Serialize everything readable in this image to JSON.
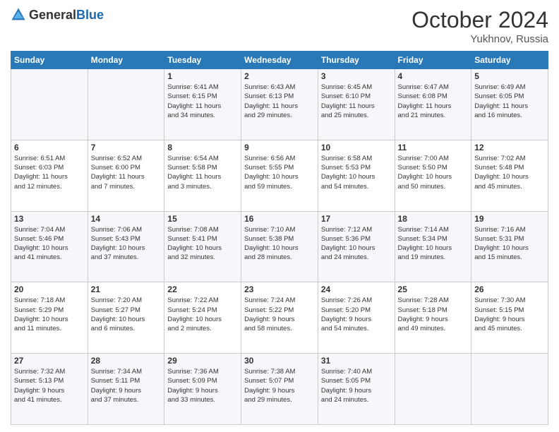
{
  "header": {
    "logo_general": "General",
    "logo_blue": "Blue",
    "month_title": "October 2024",
    "location": "Yukhnov, Russia"
  },
  "days_of_week": [
    "Sunday",
    "Monday",
    "Tuesday",
    "Wednesday",
    "Thursday",
    "Friday",
    "Saturday"
  ],
  "weeks": [
    [
      {
        "day": "",
        "info": ""
      },
      {
        "day": "",
        "info": ""
      },
      {
        "day": "1",
        "info": "Sunrise: 6:41 AM\nSunset: 6:15 PM\nDaylight: 11 hours\nand 34 minutes."
      },
      {
        "day": "2",
        "info": "Sunrise: 6:43 AM\nSunset: 6:13 PM\nDaylight: 11 hours\nand 29 minutes."
      },
      {
        "day": "3",
        "info": "Sunrise: 6:45 AM\nSunset: 6:10 PM\nDaylight: 11 hours\nand 25 minutes."
      },
      {
        "day": "4",
        "info": "Sunrise: 6:47 AM\nSunset: 6:08 PM\nDaylight: 11 hours\nand 21 minutes."
      },
      {
        "day": "5",
        "info": "Sunrise: 6:49 AM\nSunset: 6:05 PM\nDaylight: 11 hours\nand 16 minutes."
      }
    ],
    [
      {
        "day": "6",
        "info": "Sunrise: 6:51 AM\nSunset: 6:03 PM\nDaylight: 11 hours\nand 12 minutes."
      },
      {
        "day": "7",
        "info": "Sunrise: 6:52 AM\nSunset: 6:00 PM\nDaylight: 11 hours\nand 7 minutes."
      },
      {
        "day": "8",
        "info": "Sunrise: 6:54 AM\nSunset: 5:58 PM\nDaylight: 11 hours\nand 3 minutes."
      },
      {
        "day": "9",
        "info": "Sunrise: 6:56 AM\nSunset: 5:55 PM\nDaylight: 10 hours\nand 59 minutes."
      },
      {
        "day": "10",
        "info": "Sunrise: 6:58 AM\nSunset: 5:53 PM\nDaylight: 10 hours\nand 54 minutes."
      },
      {
        "day": "11",
        "info": "Sunrise: 7:00 AM\nSunset: 5:50 PM\nDaylight: 10 hours\nand 50 minutes."
      },
      {
        "day": "12",
        "info": "Sunrise: 7:02 AM\nSunset: 5:48 PM\nDaylight: 10 hours\nand 45 minutes."
      }
    ],
    [
      {
        "day": "13",
        "info": "Sunrise: 7:04 AM\nSunset: 5:46 PM\nDaylight: 10 hours\nand 41 minutes."
      },
      {
        "day": "14",
        "info": "Sunrise: 7:06 AM\nSunset: 5:43 PM\nDaylight: 10 hours\nand 37 minutes."
      },
      {
        "day": "15",
        "info": "Sunrise: 7:08 AM\nSunset: 5:41 PM\nDaylight: 10 hours\nand 32 minutes."
      },
      {
        "day": "16",
        "info": "Sunrise: 7:10 AM\nSunset: 5:38 PM\nDaylight: 10 hours\nand 28 minutes."
      },
      {
        "day": "17",
        "info": "Sunrise: 7:12 AM\nSunset: 5:36 PM\nDaylight: 10 hours\nand 24 minutes."
      },
      {
        "day": "18",
        "info": "Sunrise: 7:14 AM\nSunset: 5:34 PM\nDaylight: 10 hours\nand 19 minutes."
      },
      {
        "day": "19",
        "info": "Sunrise: 7:16 AM\nSunset: 5:31 PM\nDaylight: 10 hours\nand 15 minutes."
      }
    ],
    [
      {
        "day": "20",
        "info": "Sunrise: 7:18 AM\nSunset: 5:29 PM\nDaylight: 10 hours\nand 11 minutes."
      },
      {
        "day": "21",
        "info": "Sunrise: 7:20 AM\nSunset: 5:27 PM\nDaylight: 10 hours\nand 6 minutes."
      },
      {
        "day": "22",
        "info": "Sunrise: 7:22 AM\nSunset: 5:24 PM\nDaylight: 10 hours\nand 2 minutes."
      },
      {
        "day": "23",
        "info": "Sunrise: 7:24 AM\nSunset: 5:22 PM\nDaylight: 9 hours\nand 58 minutes."
      },
      {
        "day": "24",
        "info": "Sunrise: 7:26 AM\nSunset: 5:20 PM\nDaylight: 9 hours\nand 54 minutes."
      },
      {
        "day": "25",
        "info": "Sunrise: 7:28 AM\nSunset: 5:18 PM\nDaylight: 9 hours\nand 49 minutes."
      },
      {
        "day": "26",
        "info": "Sunrise: 7:30 AM\nSunset: 5:15 PM\nDaylight: 9 hours\nand 45 minutes."
      }
    ],
    [
      {
        "day": "27",
        "info": "Sunrise: 7:32 AM\nSunset: 5:13 PM\nDaylight: 9 hours\nand 41 minutes."
      },
      {
        "day": "28",
        "info": "Sunrise: 7:34 AM\nSunset: 5:11 PM\nDaylight: 9 hours\nand 37 minutes."
      },
      {
        "day": "29",
        "info": "Sunrise: 7:36 AM\nSunset: 5:09 PM\nDaylight: 9 hours\nand 33 minutes."
      },
      {
        "day": "30",
        "info": "Sunrise: 7:38 AM\nSunset: 5:07 PM\nDaylight: 9 hours\nand 29 minutes."
      },
      {
        "day": "31",
        "info": "Sunrise: 7:40 AM\nSunset: 5:05 PM\nDaylight: 9 hours\nand 24 minutes."
      },
      {
        "day": "",
        "info": ""
      },
      {
        "day": "",
        "info": ""
      }
    ]
  ]
}
